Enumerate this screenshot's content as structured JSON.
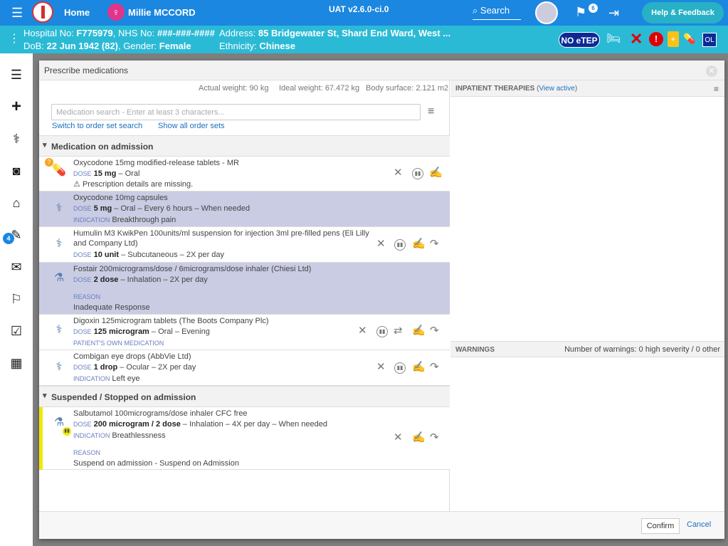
{
  "topbar": {
    "home": "Home",
    "patient_name": "Millie MCCORD",
    "version": "UAT v2.6.0-ci.0",
    "search": "Search",
    "flag_count": "6",
    "help": "Help & Feedback"
  },
  "banner": {
    "hospital": "Hospital No: ",
    "hospital_val": "F775979",
    "nhs": ", NHS No: ",
    "nhs_val": "###-###-####",
    "dob": "DoB: ",
    "dob_val": "22 Jun 1942 (82)",
    "gender": ", Gender: ",
    "gender_val": "Female",
    "address": "Address: ",
    "address_val": "85 Bridgewater St, Shard End Ward, West ...",
    "eth": "Ethnicity: ",
    "eth_val": "Chinese",
    "noetep": "NO eTEP",
    "ol": "OL"
  },
  "sidebar": {
    "badge": "4"
  },
  "modal": {
    "title": "Prescribe medications",
    "actual_weight": "Actual weight: 90 kg",
    "ideal_weight": "Ideal weight: 67.472 kg",
    "body_surface": "Body surface: 2.121 m2",
    "search_placeholder": "Medication search - Enter at least 3 characters...",
    "switch_link": "Switch to order set search",
    "show_all_link": "Show all order sets",
    "section1": "Medication on admission",
    "section2": "Suspended / Stopped on admission",
    "meds": [
      {
        "name": "Oxycodone 15mg modified-release tablets - MR",
        "dose_label": "DOSE",
        "dose": "15 mg",
        "rest": " – Oral",
        "warning": "Prescription details are missing."
      },
      {
        "name": "Oxycodone 10mg capsules",
        "dose_label": "DOSE",
        "dose": "5 mg",
        "rest": " – Oral – Every 6 hours – When needed",
        "ind_label": "INDICATION",
        "ind": "Breakthrough pain"
      },
      {
        "name": "Humulin M3 KwikPen 100units/ml suspension for injection 3ml pre-filled pens (Eli Lilly and Company Ltd)",
        "dose_label": "DOSE",
        "dose": "10 unit",
        "rest": " – Subcutaneous – 2X per day"
      },
      {
        "name": "Fostair 200micrograms/dose / 6micrograms/dose inhaler (Chiesi Ltd)",
        "dose_label": "DOSE",
        "dose": "2 dose",
        "rest": " – Inhalation – 2X per day",
        "reason_label": "REASON",
        "reason": "Inadequate Response"
      },
      {
        "name": "Digoxin 125microgram tablets (The Boots Company Plc)",
        "dose_label": "DOSE",
        "dose": "125 microgram",
        "rest": " – Oral – Evening",
        "own": "PATIENT'S OWN MEDICATION"
      },
      {
        "name": "Combigan eye drops (AbbVie Ltd)",
        "dose_label": "DOSE",
        "dose": "1 drop",
        "rest": " – Ocular – 2X per day",
        "ind_label": "INDICATION",
        "ind": "Left eye"
      },
      {
        "name": "Salbutamol 100micrograms/dose inhaler CFC free",
        "dose_label": "DOSE",
        "dose": "200 microgram / 2 dose",
        "rest": " – Inhalation – 4X per day – When needed",
        "ind_label": "INDICATION",
        "ind": "Breathlessness",
        "reason_label": "REASON",
        "reason": "Suspend on admission - Suspend on Admission"
      }
    ],
    "inpatient": "INPATIENT THERAPIES",
    "view_active": "View active",
    "warnings": "WARNINGS",
    "warnings_count": "Number of warnings: 0 high severity / 0 other",
    "confirm": "Confirm",
    "cancel": "Cancel"
  }
}
